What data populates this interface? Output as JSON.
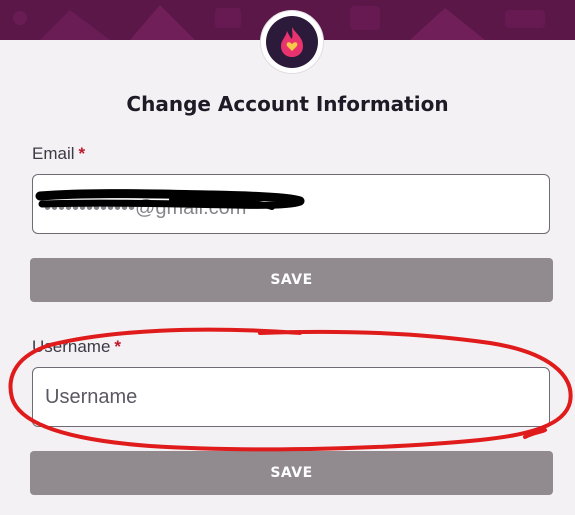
{
  "logo": {
    "icon": "flame-heart-icon",
    "colors": {
      "ring": "#ffffff",
      "inner": "#2c1a3a",
      "flame": "#e8336e",
      "heart": "#f7c948"
    }
  },
  "header": {
    "banner_color": "#5a1747"
  },
  "title": "Change Account Information",
  "email": {
    "label": "Email",
    "required_marker": "*",
    "value": "•••••••••••••@gmail.com",
    "redacted": true
  },
  "email_save": {
    "label": "SAVE"
  },
  "username": {
    "label": "Username",
    "required_marker": "*",
    "placeholder": "Username",
    "value": ""
  },
  "username_save": {
    "label": "SAVE"
  },
  "colors": {
    "button": "#918b90",
    "required": "#c0162a",
    "annotation": "#e01b1b",
    "background": "#f3f1f4"
  }
}
